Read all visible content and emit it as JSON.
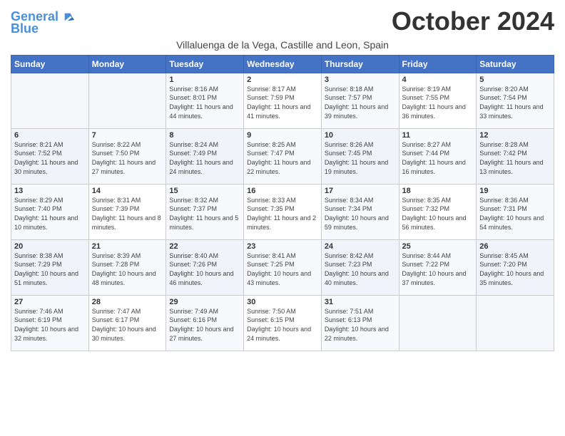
{
  "header": {
    "logo_line1": "General",
    "logo_line2": "Blue",
    "month": "October 2024",
    "location": "Villaluenga de la Vega, Castille and Leon, Spain"
  },
  "weekdays": [
    "Sunday",
    "Monday",
    "Tuesday",
    "Wednesday",
    "Thursday",
    "Friday",
    "Saturday"
  ],
  "weeks": [
    [
      {
        "day": "",
        "info": ""
      },
      {
        "day": "",
        "info": ""
      },
      {
        "day": "1",
        "info": "Sunrise: 8:16 AM\nSunset: 8:01 PM\nDaylight: 11 hours and 44 minutes."
      },
      {
        "day": "2",
        "info": "Sunrise: 8:17 AM\nSunset: 7:59 PM\nDaylight: 11 hours and 41 minutes."
      },
      {
        "day": "3",
        "info": "Sunrise: 8:18 AM\nSunset: 7:57 PM\nDaylight: 11 hours and 39 minutes."
      },
      {
        "day": "4",
        "info": "Sunrise: 8:19 AM\nSunset: 7:55 PM\nDaylight: 11 hours and 36 minutes."
      },
      {
        "day": "5",
        "info": "Sunrise: 8:20 AM\nSunset: 7:54 PM\nDaylight: 11 hours and 33 minutes."
      }
    ],
    [
      {
        "day": "6",
        "info": "Sunrise: 8:21 AM\nSunset: 7:52 PM\nDaylight: 11 hours and 30 minutes."
      },
      {
        "day": "7",
        "info": "Sunrise: 8:22 AM\nSunset: 7:50 PM\nDaylight: 11 hours and 27 minutes."
      },
      {
        "day": "8",
        "info": "Sunrise: 8:24 AM\nSunset: 7:49 PM\nDaylight: 11 hours and 24 minutes."
      },
      {
        "day": "9",
        "info": "Sunrise: 8:25 AM\nSunset: 7:47 PM\nDaylight: 11 hours and 22 minutes."
      },
      {
        "day": "10",
        "info": "Sunrise: 8:26 AM\nSunset: 7:45 PM\nDaylight: 11 hours and 19 minutes."
      },
      {
        "day": "11",
        "info": "Sunrise: 8:27 AM\nSunset: 7:44 PM\nDaylight: 11 hours and 16 minutes."
      },
      {
        "day": "12",
        "info": "Sunrise: 8:28 AM\nSunset: 7:42 PM\nDaylight: 11 hours and 13 minutes."
      }
    ],
    [
      {
        "day": "13",
        "info": "Sunrise: 8:29 AM\nSunset: 7:40 PM\nDaylight: 11 hours and 10 minutes."
      },
      {
        "day": "14",
        "info": "Sunrise: 8:31 AM\nSunset: 7:39 PM\nDaylight: 11 hours and 8 minutes."
      },
      {
        "day": "15",
        "info": "Sunrise: 8:32 AM\nSunset: 7:37 PM\nDaylight: 11 hours and 5 minutes."
      },
      {
        "day": "16",
        "info": "Sunrise: 8:33 AM\nSunset: 7:35 PM\nDaylight: 11 hours and 2 minutes."
      },
      {
        "day": "17",
        "info": "Sunrise: 8:34 AM\nSunset: 7:34 PM\nDaylight: 10 hours and 59 minutes."
      },
      {
        "day": "18",
        "info": "Sunrise: 8:35 AM\nSunset: 7:32 PM\nDaylight: 10 hours and 56 minutes."
      },
      {
        "day": "19",
        "info": "Sunrise: 8:36 AM\nSunset: 7:31 PM\nDaylight: 10 hours and 54 minutes."
      }
    ],
    [
      {
        "day": "20",
        "info": "Sunrise: 8:38 AM\nSunset: 7:29 PM\nDaylight: 10 hours and 51 minutes."
      },
      {
        "day": "21",
        "info": "Sunrise: 8:39 AM\nSunset: 7:28 PM\nDaylight: 10 hours and 48 minutes."
      },
      {
        "day": "22",
        "info": "Sunrise: 8:40 AM\nSunset: 7:26 PM\nDaylight: 10 hours and 46 minutes."
      },
      {
        "day": "23",
        "info": "Sunrise: 8:41 AM\nSunset: 7:25 PM\nDaylight: 10 hours and 43 minutes."
      },
      {
        "day": "24",
        "info": "Sunrise: 8:42 AM\nSunset: 7:23 PM\nDaylight: 10 hours and 40 minutes."
      },
      {
        "day": "25",
        "info": "Sunrise: 8:44 AM\nSunset: 7:22 PM\nDaylight: 10 hours and 37 minutes."
      },
      {
        "day": "26",
        "info": "Sunrise: 8:45 AM\nSunset: 7:20 PM\nDaylight: 10 hours and 35 minutes."
      }
    ],
    [
      {
        "day": "27",
        "info": "Sunrise: 7:46 AM\nSunset: 6:19 PM\nDaylight: 10 hours and 32 minutes."
      },
      {
        "day": "28",
        "info": "Sunrise: 7:47 AM\nSunset: 6:17 PM\nDaylight: 10 hours and 30 minutes."
      },
      {
        "day": "29",
        "info": "Sunrise: 7:49 AM\nSunset: 6:16 PM\nDaylight: 10 hours and 27 minutes."
      },
      {
        "day": "30",
        "info": "Sunrise: 7:50 AM\nSunset: 6:15 PM\nDaylight: 10 hours and 24 minutes."
      },
      {
        "day": "31",
        "info": "Sunrise: 7:51 AM\nSunset: 6:13 PM\nDaylight: 10 hours and 22 minutes."
      },
      {
        "day": "",
        "info": ""
      },
      {
        "day": "",
        "info": ""
      }
    ]
  ]
}
